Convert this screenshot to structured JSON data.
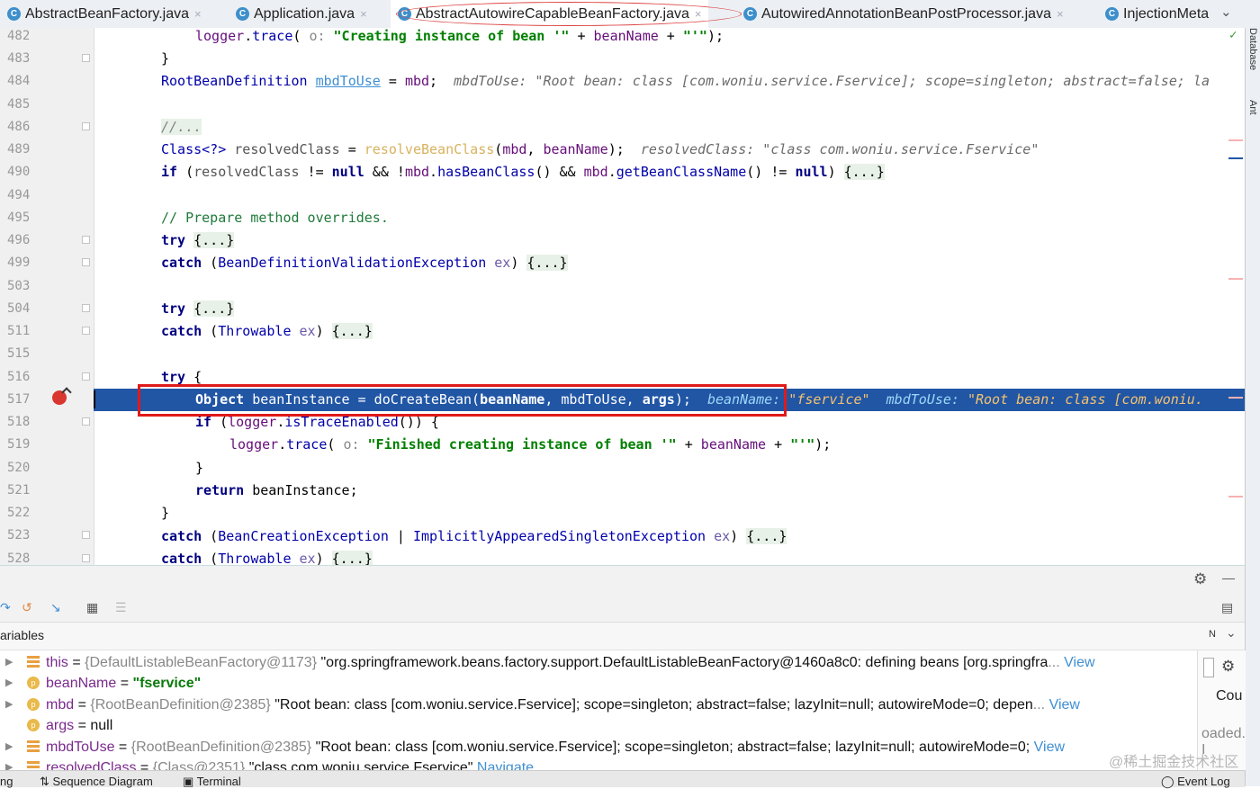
{
  "tabs": [
    {
      "label": "AbstractBeanFactory.java",
      "icon": "C",
      "active": false
    },
    {
      "label": "Application.java",
      "icon": "C",
      "active": false
    },
    {
      "label": "AbstractAutowireCapableBeanFactory.java",
      "icon": "C",
      "active": true
    },
    {
      "label": "AutowiredAnnotationBeanPostProcessor.java",
      "icon": "C",
      "active": false
    },
    {
      "label": "InjectionMeta",
      "icon": "C",
      "active": false
    }
  ],
  "tab_close": "×",
  "tab_more": "⌄",
  "line_numbers": [
    "482",
    "483",
    "484",
    "485",
    "486",
    "489",
    "490",
    "494",
    "495",
    "496",
    "499",
    "503",
    "504",
    "511",
    "515",
    "516",
    "517",
    "518",
    "519",
    "520",
    "521",
    "522",
    "523",
    "528"
  ],
  "code": {
    "l482": {
      "a": "logger",
      "b": ".",
      "c": "trace",
      "d": "( ",
      "e": "o:",
      "f": " ",
      "g": "\"Creating instance of bean '\"",
      "h": " + ",
      "i": "beanName",
      "j": " + ",
      "k": "\"'\"",
      "l": ");"
    },
    "l483": "}",
    "l484": {
      "type": "RootBeanDefinition",
      "sp": " ",
      "var": "mbdToUse",
      "eq": " = ",
      "mbd": "mbd",
      "semi": ";",
      "hint": "mbdToUse: \"Root bean: class [com.woniu.service.Fservice]; scope=singleton; abstract=false; la"
    },
    "l486": "//...",
    "l489": {
      "a": "Class<?>",
      "b": " ",
      "c": "resolvedClass",
      "d": " = ",
      "e": "resolveBeanClass",
      "f": "(",
      "g": "mbd",
      "h": ", ",
      "i": "beanName",
      "j": ");",
      "hint": "resolvedClass: \"class com.woniu.service.Fservice\""
    },
    "l490": {
      "a": "if",
      "b": " (",
      "c": "resolvedClass",
      "d": " != ",
      "e": "null",
      "f": " && !",
      "g": "mbd",
      "h": ".",
      "i": "hasBeanClass",
      "j": "() && ",
      "k": "mbd",
      "l": ".",
      "m": "getBeanClassName",
      "n": "() != ",
      "o": "null",
      "p": ") ",
      "q": "{...}"
    },
    "l495": "// Prepare method overrides.",
    "l496": {
      "a": "try",
      "b": " ",
      "c": "{...}"
    },
    "l499": {
      "a": "catch",
      "b": " (",
      "c": "BeanDefinitionValidationException",
      "d": " ",
      "e": "ex",
      "f": ") ",
      "g": "{...}"
    },
    "l504": {
      "a": "try",
      "b": " ",
      "c": "{...}"
    },
    "l511": {
      "a": "catch",
      "b": " (",
      "c": "Throwable",
      "d": " ",
      "e": "ex",
      "f": ") ",
      "g": "{...}"
    },
    "l516": {
      "a": "try",
      "b": " {"
    },
    "l517": {
      "a": "Object",
      "b": " beanInstance = doCreateBean(",
      "c": "beanName",
      "d": ", ",
      "e": "mbdToUse",
      "f": ", ",
      "g": "args",
      "h": ");",
      "hint1": "beanName:",
      "hint2": "\"fservice\"",
      "hint3": "mbdToUse:",
      "hint4": "\"Root bean: class [com.woniu."
    },
    "l518": {
      "a": "if",
      "b": " (",
      "c": "logger",
      "d": ".",
      "e": "isTraceEnabled",
      "f": "()) {"
    },
    "l519": {
      "a": "logger",
      "b": ".",
      "c": "trace",
      "d": "( ",
      "e": "o:",
      "f": " ",
      "g": "\"Finished creating instance of bean '\"",
      "h": " + ",
      "i": "beanName",
      "j": " + ",
      "k": "\"'\"",
      "l": ");"
    },
    "l520": "}",
    "l521": {
      "a": "return",
      "b": " beanInstance;"
    },
    "l522": "}",
    "l523": {
      "a": "catch",
      "b": " (",
      "c": "BeanCreationException",
      "d": " | ",
      "e": "ImplicitlyAppearedSingletonException",
      "f": " ",
      "g": "ex",
      "h": ") ",
      "i": "{...}"
    },
    "l528": {
      "a": "catch",
      "b": " (",
      "c": "Throwable",
      "d": " ",
      "e": "ex",
      "f": ") ",
      "g": "{...}"
    }
  },
  "right_strip": {
    "database": "Database",
    "ant": "Ant"
  },
  "debug": {
    "panel_title": "ariables",
    "settings_icon": "⚙",
    "minimize_icon": "—",
    "variables": [
      {
        "name": "this",
        "type": "{DefaultListableBeanFactory@1173}",
        "value": "\"org.springframework.beans.factory.support.DefaultListableBeanFactory@1460a8c0: defining beans [org.springfra",
        "ellipsis": "...",
        "view": "View",
        "expandable": true,
        "icon": "≡"
      },
      {
        "name": "beanName",
        "type": "",
        "value": "\"fservice\"",
        "ellipsis": "",
        "view": "",
        "expandable": true,
        "icon": "p"
      },
      {
        "name": "mbd",
        "type": "{RootBeanDefinition@2385}",
        "value": "\"Root bean: class [com.woniu.service.Fservice]; scope=singleton; abstract=false; lazyInit=null; autowireMode=0; depen",
        "ellipsis": "...",
        "view": "View",
        "expandable": true,
        "icon": "p"
      },
      {
        "name": "args",
        "type": "",
        "value": "null",
        "ellipsis": "",
        "view": "",
        "expandable": false,
        "icon": "p"
      },
      {
        "name": "mbdToUse",
        "type": "{RootBeanDefinition@2385}",
        "value": "\"Root bean: class [com.woniu.service.Fservice]; scope=singleton; abstract=false; lazyInit=null; autowireMode=0;",
        "ellipsis": "",
        "view": "View",
        "expandable": true,
        "icon": "≡"
      },
      {
        "name": "resolvedClass",
        "type": "{Class@2351}",
        "value": "\"class com.woniu.service.Fservice\"",
        "ellipsis": "",
        "view": "Navigate",
        "expandable": true,
        "icon": "≡"
      }
    ],
    "side": {
      "n_label": "N",
      "count_label": "Cou",
      "loaded_label": "oaded. I"
    }
  },
  "bottom_tabs": {
    "left": "ng",
    "sequence": "Sequence Diagram",
    "terminal": "Terminal",
    "event_log": "Event Log"
  },
  "watermark": "@稀土掘金技术社区",
  "colors": {
    "selection": "#2156a5",
    "redbox": "#e01a1a",
    "keyword": "#000080",
    "string": "#008000"
  }
}
